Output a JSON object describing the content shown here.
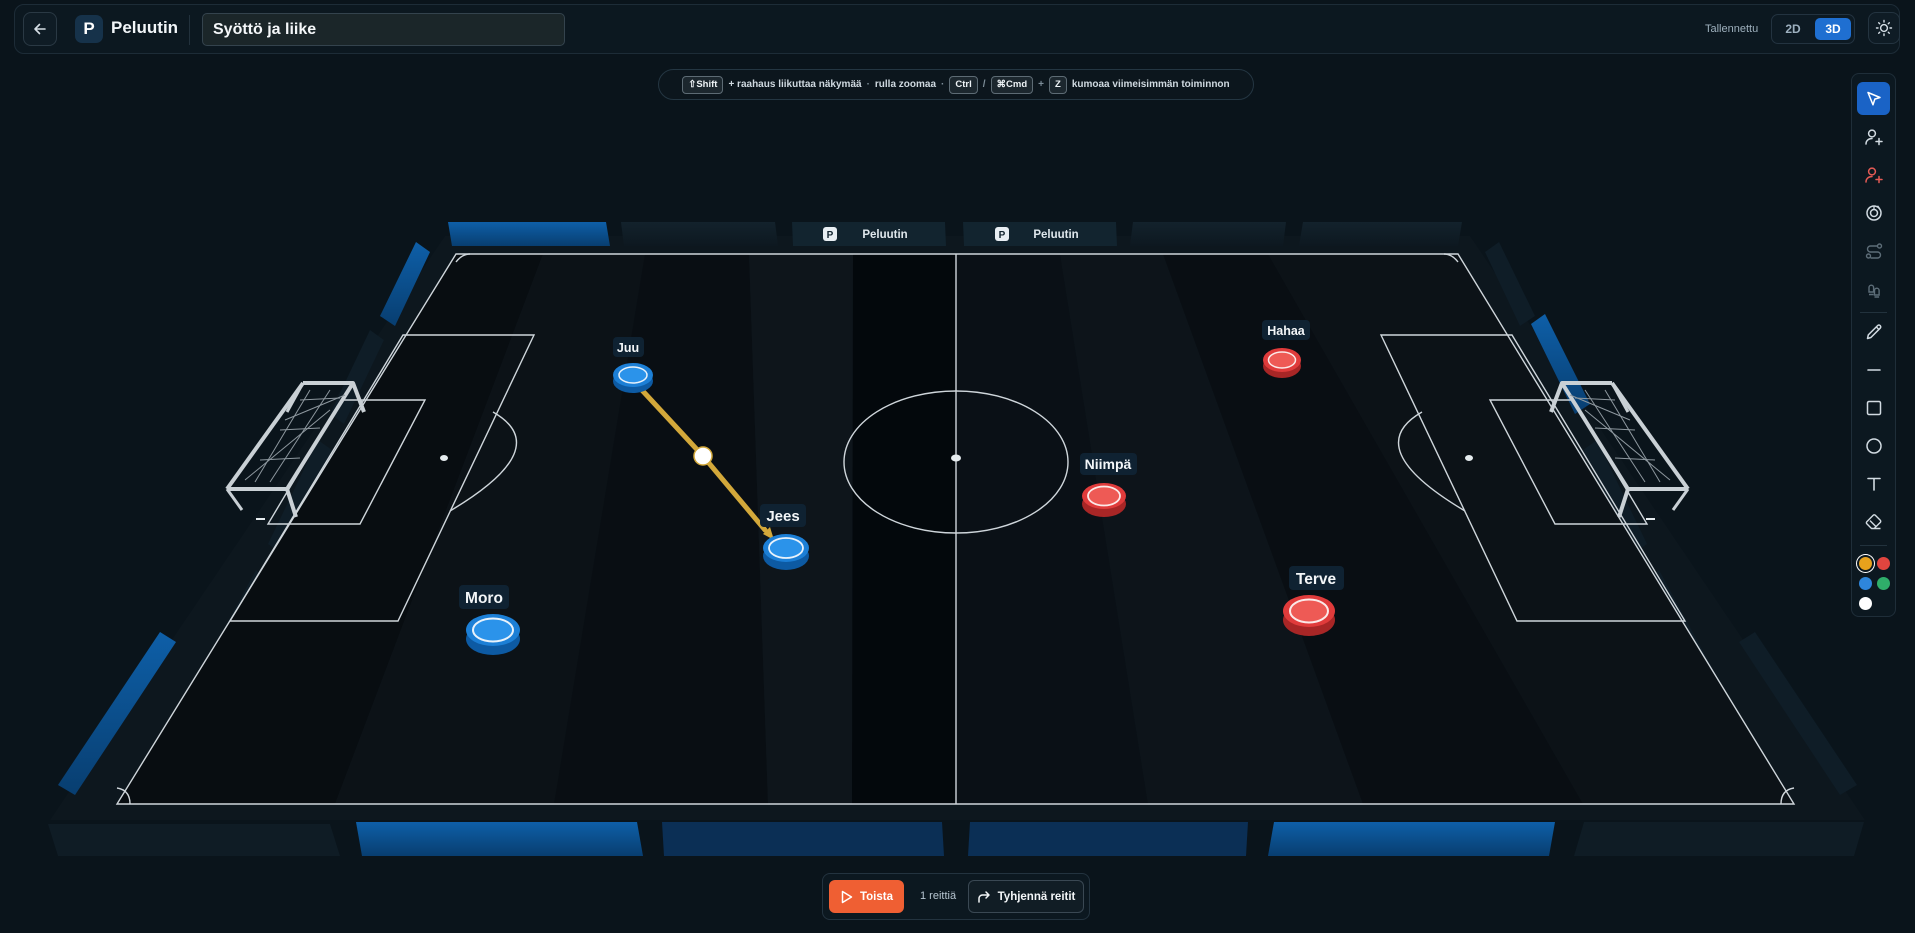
{
  "header": {
    "back_icon": "arrow-left-icon",
    "logo_letter": "P",
    "app_name": "Peluutin",
    "board_title": "Syöttö ja liike",
    "save_status": "Tallennettu",
    "view_2d": "2D",
    "view_3d": "3D",
    "active_view": "3D",
    "theme_icon": "sun-icon"
  },
  "hint": {
    "key_shift": "⇧Shift",
    "text_drag": "+ raahaus liikuttaa näkymää",
    "sep1": "·",
    "text_scroll": "rulla zoomaa",
    "sep2": "·",
    "key_ctrl": "Ctrl",
    "slash": "/",
    "key_cmd": "⌘Cmd",
    "plus": "+",
    "key_z": "Z",
    "text_undo": "kumoaa viimeisimmän toiminnon"
  },
  "field": {
    "ad_boards": [
      {
        "label": "Peluutin"
      },
      {
        "label": "Peluutin"
      }
    ],
    "players_blue": [
      {
        "name": "Juu"
      },
      {
        "name": "Jees"
      },
      {
        "name": "Moro"
      }
    ],
    "players_red": [
      {
        "name": "Hahaa"
      },
      {
        "name": "Niimpä"
      },
      {
        "name": "Terve"
      }
    ],
    "pass_route_color": "#d3a83a",
    "team_blue_color": "#1c7fd6",
    "team_red_color": "#e03b3b",
    "line_color": "#cfd6db"
  },
  "toolbar": {
    "tools": [
      {
        "name": "select-icon",
        "selected": true
      },
      {
        "name": "add-player-blue-icon"
      },
      {
        "name": "add-player-red-icon"
      },
      {
        "name": "ball-icon"
      },
      {
        "name": "route-icon"
      },
      {
        "name": "footsteps-icon"
      },
      {
        "name": "pencil-icon"
      },
      {
        "name": "line-icon"
      },
      {
        "name": "rectangle-icon"
      },
      {
        "name": "circle-icon"
      },
      {
        "name": "text-icon"
      },
      {
        "name": "eraser-icon"
      }
    ],
    "colors": [
      "#e8a21c",
      "#e0453f",
      "#2e86db",
      "#2fae6a",
      "#ffffff"
    ],
    "selected_color": "#e8a21c"
  },
  "playback": {
    "play_label": "Toista",
    "route_count": "1 reittiä",
    "clear_label": "Tyhjennä reitit"
  }
}
